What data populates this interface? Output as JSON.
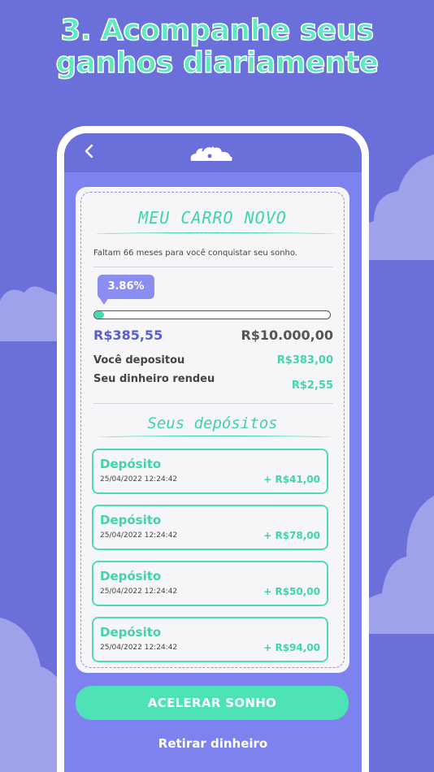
{
  "headline": {
    "line1": "3. Acompanhe seus",
    "line2": "ganhos diariamente"
  },
  "icons": {
    "back": "chevron-left-icon",
    "logo": "cloud-logo-icon"
  },
  "goal": {
    "title": "MEU CARRO NOVO",
    "remaining_text": "Faltam 66 meses para você conquistar seu sonho.",
    "progress_percent_label": "3.86%",
    "progress_fraction": 0.0386,
    "saved_amount": "R$385,55",
    "target_amount": "R$10.000,00",
    "deposited_label": "Você depositou",
    "deposited_value": "R$383,00",
    "earned_label": "Seu dinheiro rendeu",
    "earned_value": "R$2,55"
  },
  "deposits_section": {
    "title": "Seus depósitos",
    "items": [
      {
        "title": "Depósito",
        "date": "25/04/2022 12:24:42",
        "amount": "+ R$41,00"
      },
      {
        "title": "Depósito",
        "date": "25/04/2022 12:24:42",
        "amount": "+ R$78,00"
      },
      {
        "title": "Depósito",
        "date": "25/04/2022 12:24:42",
        "amount": "+ R$50,00"
      },
      {
        "title": "Depósito",
        "date": "25/04/2022 12:24:42",
        "amount": "+ R$94,00"
      }
    ]
  },
  "actions": {
    "accelerate_label": "ACELERAR SONHO",
    "withdraw_label": "Retirar dinheiro"
  },
  "colors": {
    "background": "#6a6fd9",
    "accent": "#44dbae",
    "screen": "#7e82ef"
  }
}
